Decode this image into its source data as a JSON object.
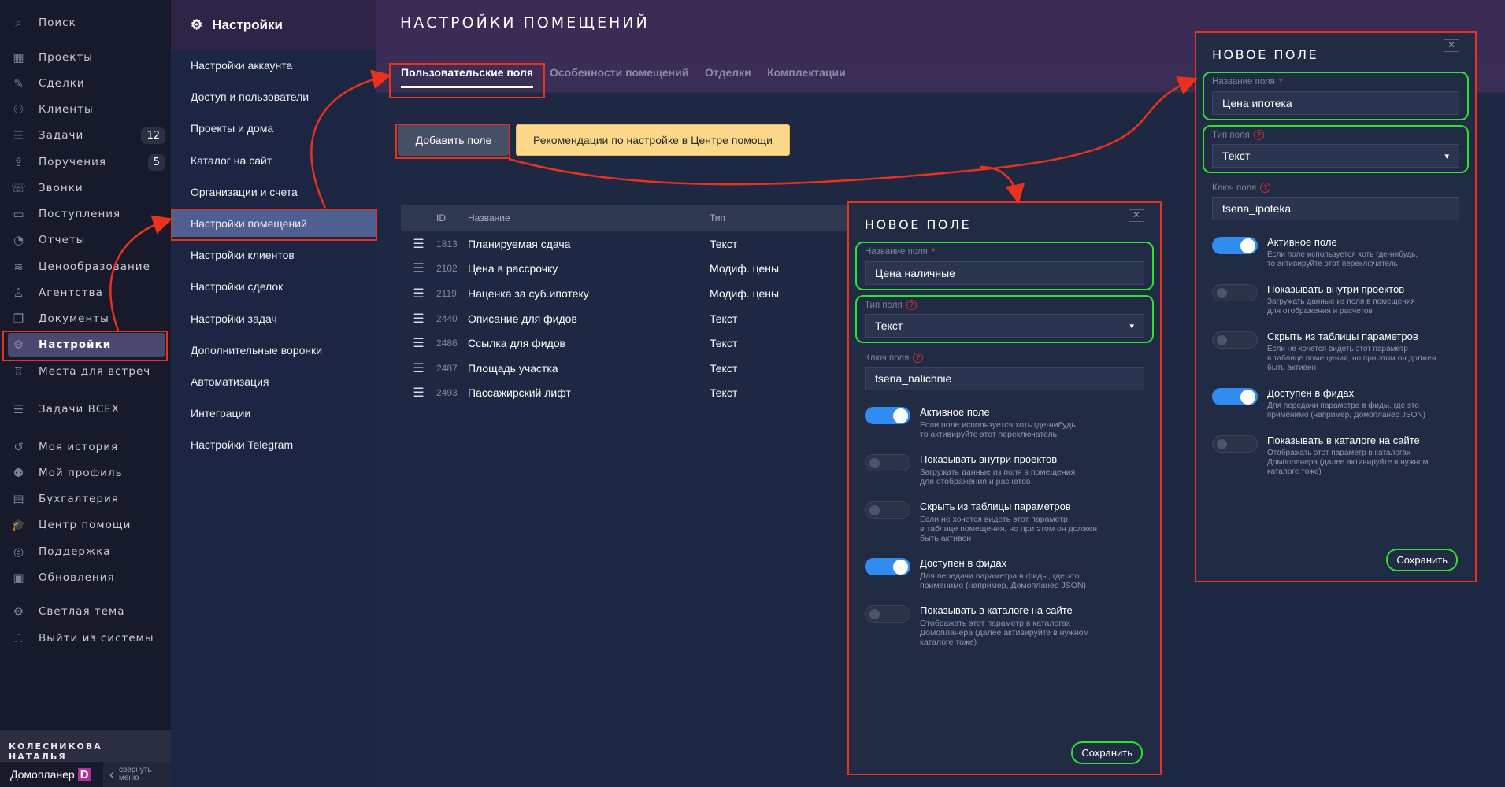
{
  "sidebar": {
    "items": [
      {
        "label": "Поиск",
        "icon": "⌕"
      },
      {
        "label": "Проекты",
        "icon": "▦"
      },
      {
        "label": "Сделки",
        "icon": "✎"
      },
      {
        "label": "Клиенты",
        "icon": "⚇"
      },
      {
        "label": "Задачи",
        "icon": "☰",
        "badge": "12"
      },
      {
        "label": "Поручения",
        "icon": "⇪",
        "badge": "5"
      },
      {
        "label": "Звонки",
        "icon": "☏"
      },
      {
        "label": "Поступления",
        "icon": "▭"
      },
      {
        "label": "Отчеты",
        "icon": "◔"
      },
      {
        "label": "Ценообразование",
        "icon": "≋"
      },
      {
        "label": "Агентства",
        "icon": "♙"
      },
      {
        "label": "Документы",
        "icon": "❐"
      },
      {
        "label": "Настройки",
        "icon": "⚙",
        "active": true
      },
      {
        "label": "Места для встреч",
        "icon": "♖"
      },
      {
        "label": "Задачи ВСЕХ",
        "icon": "☰"
      },
      {
        "label": "Моя история",
        "icon": "↺"
      },
      {
        "label": "Мой профиль",
        "icon": "⚉"
      },
      {
        "label": "Бухгалтерия",
        "icon": "▤"
      },
      {
        "label": "Центр помощи",
        "icon": "🎓"
      },
      {
        "label": "Поддержка",
        "icon": "◎"
      },
      {
        "label": "Обновления",
        "icon": "▣"
      },
      {
        "label": "Светлая тема",
        "icon": "⚙"
      },
      {
        "label": "Выйти из системы",
        "icon": "⎍"
      }
    ],
    "user": "КОЛЕСНИКОВА НАТАЛЬЯ",
    "brand": "Домопланер",
    "brand_logo": "D",
    "collapse_label": "свернуть меню"
  },
  "submenu": {
    "title": "Настройки",
    "items": [
      "Настройки аккаунта",
      "Доступ и пользователи",
      "Проекты и дома",
      "Каталог на сайт",
      "Организации и счета",
      "Настройки помещений",
      "Настройки клиентов",
      "Настройки сделок",
      "Настройки задач",
      "Дополнительные воронки",
      "Автоматизация",
      "Интеграции",
      "Настройки Telegram"
    ],
    "active_index": 5
  },
  "main": {
    "title": "НАСТРОЙКИ ПОМЕЩЕНИЙ",
    "tabs": [
      "Пользовательские поля",
      "Особенности помещений",
      "Отделки",
      "Комплектации"
    ],
    "add_button": "Добавить поле",
    "help_button": "Рекомендации по настройке в Центре помощи",
    "table": {
      "headers": [
        "ID",
        "Название",
        "Тип"
      ],
      "rows": [
        [
          "1813",
          "Планируемая сдача",
          "Текст"
        ],
        [
          "2102",
          "Цена в рассрочку",
          "Модиф. цены"
        ],
        [
          "2119",
          "Наценка за суб.ипотеку",
          "Модиф. цены"
        ],
        [
          "2440",
          "Описание для фидов",
          "Текст"
        ],
        [
          "2486",
          "Ссылка для фидов",
          "Текст"
        ],
        [
          "2487",
          "Площадь участка",
          "Текст"
        ],
        [
          "2493",
          "Пассажирский лифт",
          "Текст"
        ]
      ]
    }
  },
  "modals": [
    {
      "title": "НОВОЕ ПОЛЕ",
      "name_label": "Название поля",
      "name_value": "Цена наличные",
      "type_label": "Тип поля",
      "type_value": "Текст",
      "key_label": "Ключ поля",
      "key_value": "tsena_nalichnie",
      "toggles": [
        {
          "title": "Активное поле",
          "desc": "Если поле используется хоть где-нибудь,\nто активируйте этот переключатель",
          "on": true
        },
        {
          "title": "Показывать внутри проектов",
          "desc": "Загружать данные из поля в помещения\nдля отображения и расчетов",
          "on": false
        },
        {
          "title": "Скрыть из таблицы параметров",
          "desc": "Если не хочется видеть этот параметр\nв таблице помещения, но при этом он должен\nбыть активен",
          "on": false
        },
        {
          "title": "Доступен в фидах",
          "desc": "Для передачи параметра в фиды, где это\nприменимо (например, Домопланер JSON)",
          "on": true
        },
        {
          "title": "Показывать в каталоге на сайте",
          "desc": "Отображать этот параметр в каталогах\nДомопланера (далее активируйте в нужном\nкаталоге тоже)",
          "on": false
        }
      ],
      "save": "Сохранить"
    },
    {
      "title": "НОВОЕ ПОЛЕ",
      "name_label": "Название поля",
      "name_value": "Цена ипотека",
      "type_label": "Тип поля",
      "type_value": "Текст",
      "key_label": "Ключ поля",
      "key_value": "tsena_ipoteka",
      "toggles": [
        {
          "title": "Активное поле",
          "desc": "Если поле используется хоть где-нибудь,\nто активируйте этот переключатель",
          "on": true
        },
        {
          "title": "Показывать внутри проектов",
          "desc": "Загружать данные из поля в помещения\nдля отображения и расчетов",
          "on": false
        },
        {
          "title": "Скрыть из таблицы параметров",
          "desc": "Если не хочется видеть этот параметр\nв таблице помещения, но при этом он должен\nбыть активен",
          "on": false
        },
        {
          "title": "Доступен в фидах",
          "desc": "Для передачи параметра в фиды, где это\nприменимо (например, Домопланер JSON)",
          "on": true
        },
        {
          "title": "Показывать в каталоге на сайте",
          "desc": "Отображать этот параметр в каталогах\nДомопланера (далее активируйте в нужном\nкаталоге тоже)",
          "on": false
        }
      ],
      "save": "Сохранить"
    }
  ],
  "colors": {
    "annotation_red": "#e8321e",
    "annotation_green": "#2fe02f",
    "toggle_on": "#2f8cf0"
  }
}
